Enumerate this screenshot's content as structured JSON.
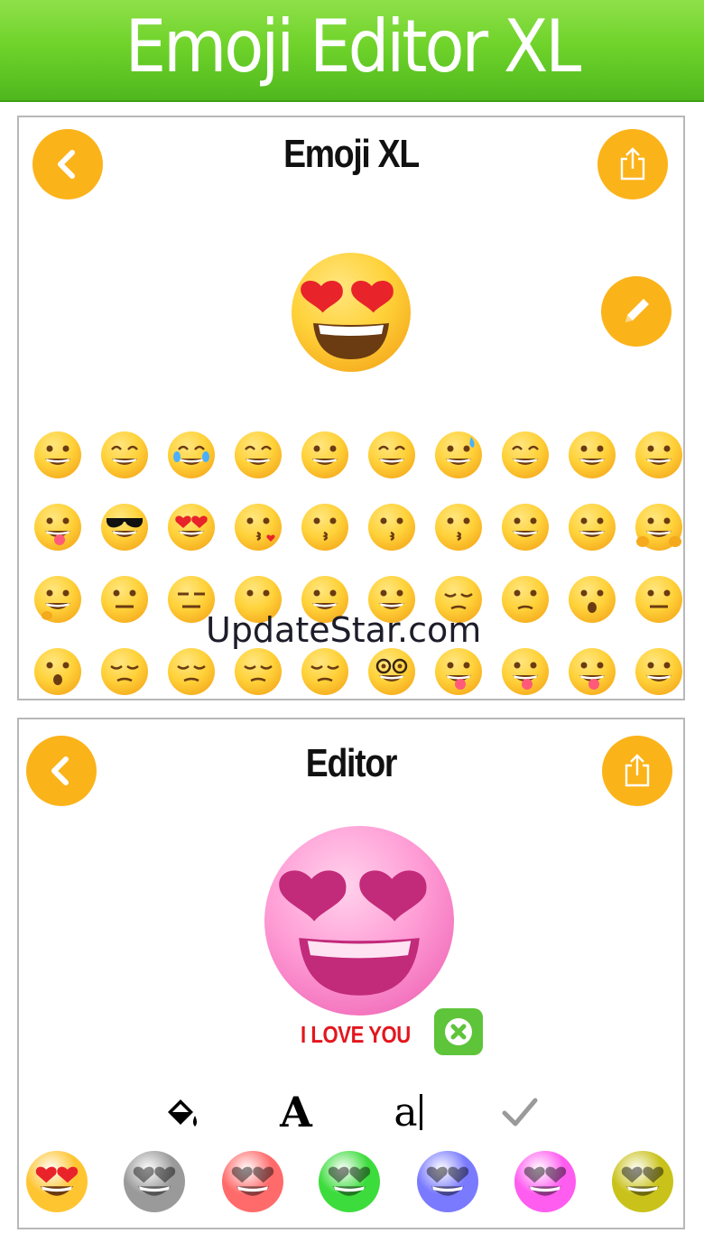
{
  "banner": {
    "title": "Emoji Editor XL"
  },
  "top_panel": {
    "title": "Emoji XL",
    "back_icon": "chevron-left-icon",
    "share_icon": "share-icon",
    "edit_icon": "pencil-icon",
    "grid": [
      [
        "grinning",
        "beaming",
        "joy",
        "rofl",
        "smiley",
        "smile",
        "sweat-smile",
        "laughing",
        "wink",
        "blush"
      ],
      [
        "yum",
        "sunglasses",
        "heart-eyes",
        "kissing-heart",
        "kissing",
        "kissing-smiling-eyes",
        "kissing-closed-eyes",
        "relaxed",
        "slight-smile",
        "hugging"
      ],
      [
        "thinking",
        "neutral",
        "expressionless",
        "no-mouth",
        "eye-roll",
        "smirk",
        "persevere",
        "disappointed-relieved",
        "open-mouth",
        "zipper-mouth"
      ],
      [
        "hushed",
        "sleepy",
        "tired",
        "sleeping",
        "relieved",
        "nerd",
        "tongue",
        "wink-tongue",
        "squint-tongue",
        "drooling"
      ]
    ]
  },
  "watermark": "UpdateStar.com",
  "bottom_panel": {
    "title": "Editor",
    "caption": "I LOVE YOU",
    "tools": [
      "paint-bucket-icon",
      "font-icon",
      "text-cursor-icon",
      "check-icon"
    ],
    "tool_glyphs": {
      "font": "A",
      "cursor": "a"
    },
    "swatches": [
      {
        "name": "original",
        "color": "#ffc531"
      },
      {
        "name": "gray",
        "color": "#9a9a9a"
      },
      {
        "name": "red",
        "color": "#ff6b6b"
      },
      {
        "name": "green",
        "color": "#3ddc3d"
      },
      {
        "name": "blue",
        "color": "#7a7aff"
      },
      {
        "name": "magenta",
        "color": "#ff5cf0"
      },
      {
        "name": "olive",
        "color": "#c9c21a"
      }
    ]
  },
  "colors": {
    "accent": "#fbb31a",
    "banner": "#6fd32a",
    "close": "#5ec43a"
  }
}
